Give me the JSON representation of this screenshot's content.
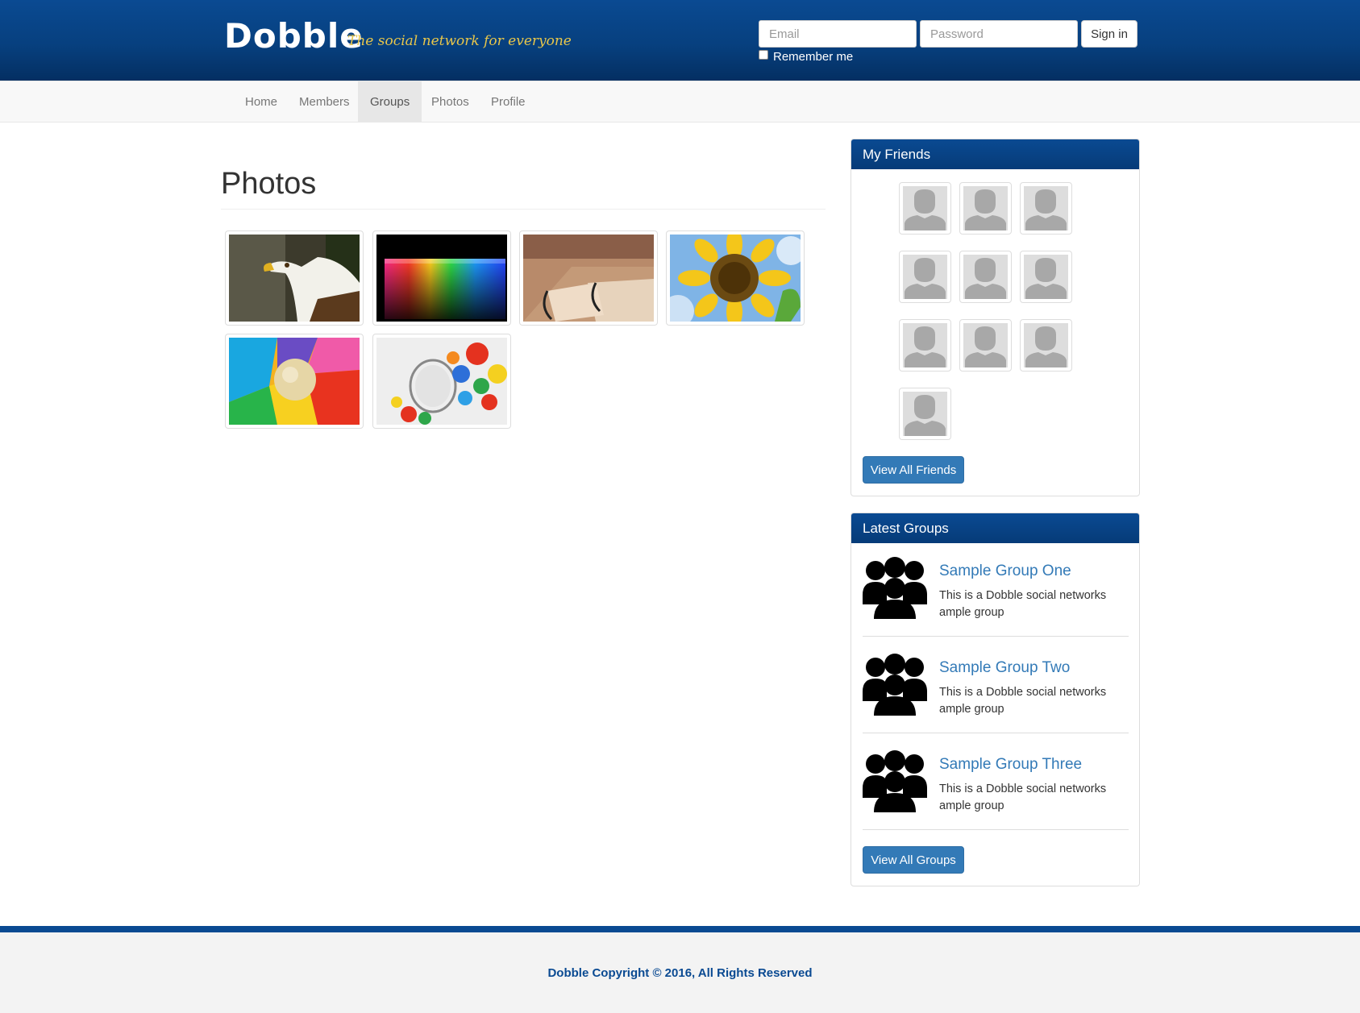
{
  "brand": {
    "name": "Dobble",
    "tagline": "The social network for everyone"
  },
  "login": {
    "email_placeholder": "Email",
    "password_placeholder": "Password",
    "signin_label": "Sign in",
    "remember_label": "Remember me"
  },
  "nav": {
    "items": [
      {
        "label": "Home"
      },
      {
        "label": "Members"
      },
      {
        "label": "Groups",
        "active": true
      },
      {
        "label": "Photos"
      },
      {
        "label": "Profile"
      }
    ]
  },
  "main": {
    "title": "Photos",
    "photos": [
      "eagle",
      "colored-tubes",
      "park-bench",
      "sunflower",
      "colorful-ball",
      "marbles-jar"
    ]
  },
  "friends_panel": {
    "title": "My Friends",
    "friend_count": 10,
    "button_label": "View All Friends"
  },
  "groups_panel": {
    "title": "Latest Groups",
    "groups": [
      {
        "name": "Sample Group One",
        "description": "This is a Dobble social networks ample group"
      },
      {
        "name": "Sample Group Two",
        "description": "This is a Dobble social networks ample group"
      },
      {
        "name": "Sample Group Three",
        "description": "This is a Dobble social networks ample group"
      }
    ],
    "button_label": "View All Groups"
  },
  "footer": {
    "text": "Dobble Copyright © 2016, All Rights Reserved"
  },
  "colors": {
    "header_blue": "#0a4a92",
    "link_blue": "#337ab7",
    "tagline_gold": "#e8c64a"
  }
}
